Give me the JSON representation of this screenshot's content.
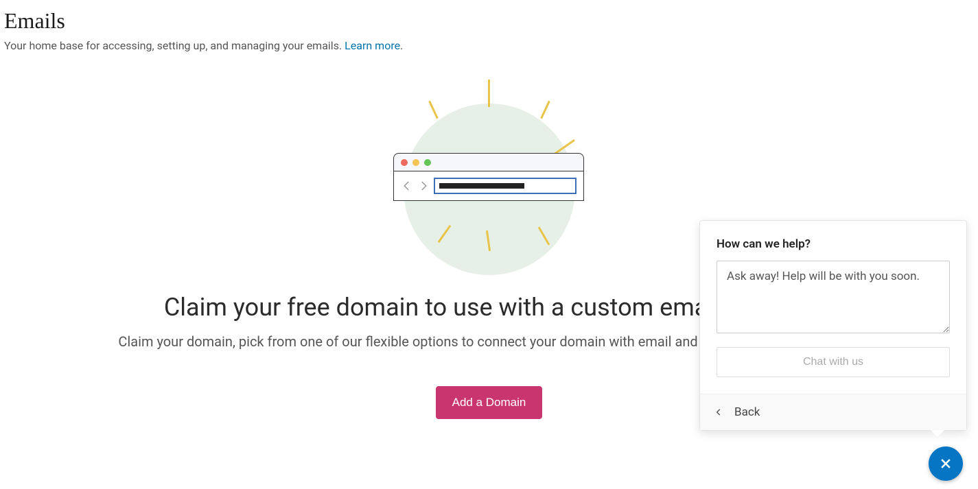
{
  "page": {
    "title": "Emails",
    "subtitle_prefix": "Your home base for accessing, setting up, and managing your emails. ",
    "learn_more": "Learn more",
    "subtitle_suffix": "."
  },
  "hero": {
    "title": "Claim your free domain to use with a custom email address",
    "subtitle": "Claim your domain, pick from one of our flexible options to connect your domain with email and start getting emails today.",
    "cta_label": "Add a Domain"
  },
  "help": {
    "title": "How can we help?",
    "placeholder": "Ask away! Help will be with you soon.",
    "chat_label": "Chat with us",
    "back_label": "Back"
  },
  "colors": {
    "accent": "#c9356e",
    "link": "#0073aa",
    "fab": "#0675c4"
  }
}
